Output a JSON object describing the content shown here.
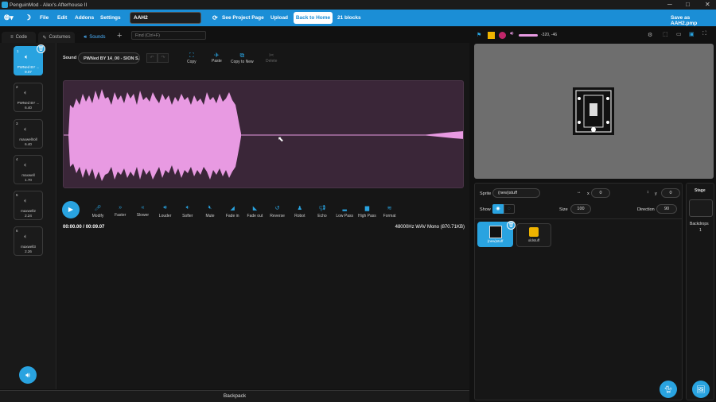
{
  "titlebar": {
    "title": "PenguinMod - Alex's Afterhouse II"
  },
  "menu": {
    "file": "File",
    "edit": "Edit",
    "addons": "Addons",
    "settings": "Settings",
    "project_title": "AAH2",
    "see_project": "See Project Page",
    "upload": "Upload",
    "back_home": "Back to Home",
    "blocks": "21 blocks",
    "save_as": "Save as AAH2.pmp"
  },
  "tabs": {
    "code": "Code",
    "costumes": "Costumes",
    "sounds": "Sounds",
    "find_placeholder": "Find (Ctrl+F)"
  },
  "sounds": [
    {
      "num": "1",
      "name": "PWNed BY ...",
      "dur": "9.07"
    },
    {
      "num": "2",
      "name": "PWNed BY ...",
      "dur": "6.40"
    },
    {
      "num": "3",
      "name": "maxwellroll",
      "dur": "6.40"
    },
    {
      "num": "4",
      "name": "maxwell",
      "dur": "1.70"
    },
    {
      "num": "5",
      "name": "maxwell2",
      "dur": "2.24"
    },
    {
      "num": "6",
      "name": "maxwell3",
      "dur": "2.26"
    }
  ],
  "editor": {
    "sound_label": "Sound",
    "sound_name": "PWNed BY 14_00 - SION S...",
    "copy": "Copy",
    "paste": "Paste",
    "copy_new": "Copy to New",
    "delete": "Delete",
    "time": "00:00.00 / 00:09.07",
    "info": "48000Hz WAV Mono (870.71KB)"
  },
  "effects": [
    "Modify",
    "Faster",
    "Slower",
    "Louder",
    "Softer",
    "Mute",
    "Fade in",
    "Fade out",
    "Reverse",
    "Robot",
    "Echo",
    "Low Pass",
    "High Pass",
    "Format"
  ],
  "backpack": "Backpack",
  "stage_header": {
    "coords": "-320, -46"
  },
  "sprite_info": {
    "sprite_label": "Sprite",
    "sprite_name": "(new)stuff",
    "x_label": "x",
    "x_val": "0",
    "y_label": "y",
    "y_val": "0",
    "show_label": "Show",
    "size_label": "Size",
    "size_val": "100",
    "direction_label": "Direction",
    "direction_val": "90"
  },
  "sprite_list": [
    {
      "name": "(new)stuff"
    },
    {
      "name": "oldstuff"
    }
  ],
  "stage_panel": {
    "title": "Stage",
    "backdrops_label": "Backdrops",
    "backdrops_count": "1"
  },
  "colors": {
    "accent": "#29a3e0",
    "menu": "#1b8ed6",
    "wave": "#e89ae2",
    "wave_bg": "#3a2638"
  }
}
